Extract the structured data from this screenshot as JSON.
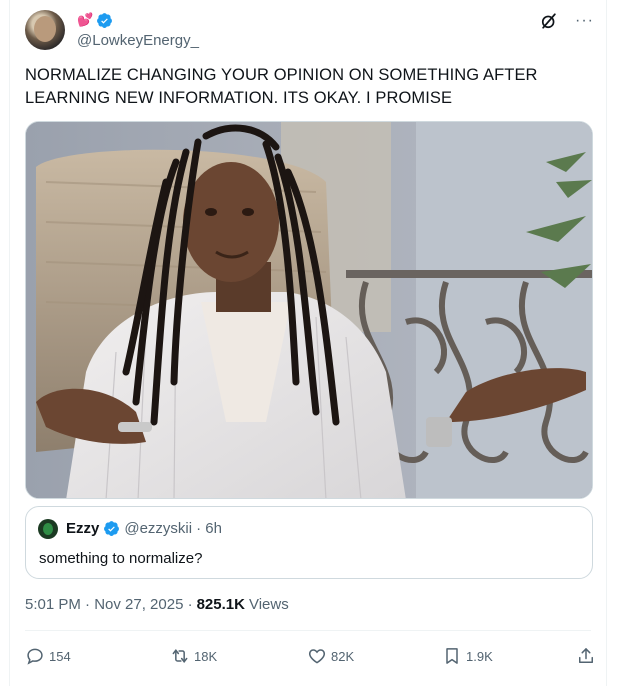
{
  "author": {
    "handle": "@LowkeyEnergy_",
    "name_emoji": "💕",
    "verified": true
  },
  "header": {
    "grok_icon": "grok-icon",
    "more_icon": "more-icon",
    "more_label": "···"
  },
  "tweet": {
    "text": "NORMALIZE CHANGING YOUR OPINION ON SOMETHING AFTER LEARNING NEW INFORMATION. ITS OKAY. I PROMISE"
  },
  "quote": {
    "name": "Ezzy",
    "handle": "@ezzyskii",
    "time": "· 6h",
    "text": "something to normalize?"
  },
  "meta": {
    "timestamp": "5:01 PM · Nov 27, 2025 ·",
    "views_count": "825.1K",
    "views_label": "Views"
  },
  "actions": {
    "replies": "154",
    "reposts": "18K",
    "likes": "82K",
    "bookmarks": "1.9K"
  },
  "colors": {
    "accent": "#1d9bf0",
    "text": "#0f1419",
    "muted": "#536471"
  }
}
